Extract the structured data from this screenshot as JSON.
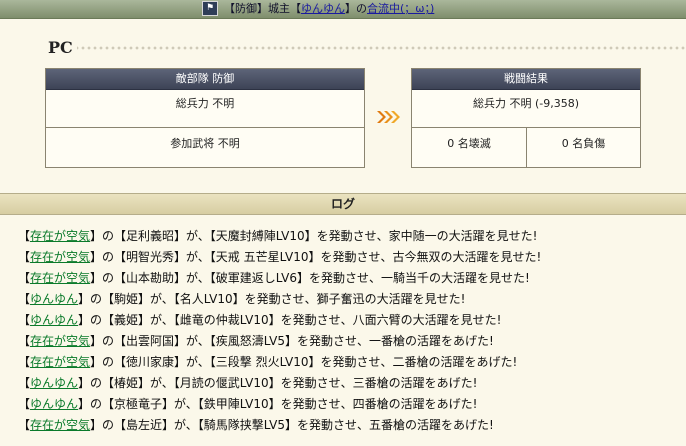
{
  "title_bar": {
    "prefix": "【防御】城主【",
    "lord_name": "ゆんゆん",
    "middle": "】の",
    "link": "合流中(；ω；)",
    "icon": "castle-flag-icon"
  },
  "section": {
    "label": "PC"
  },
  "left_panel": {
    "header": "敵部隊 防御",
    "total_strength": "総兵力 不明",
    "participants": "参加武将 不明"
  },
  "right_panel": {
    "header": "戦闘結果",
    "total_strength": "総兵力 不明 (-9,358)",
    "destroyed": "0 名壊滅",
    "wounded": "0 名負傷"
  },
  "arrow_icon": "triple-chevron-right-icon",
  "log": {
    "header": "ログ",
    "entries": [
      {
        "actor": "存在が空気",
        "text": "の【足利義昭】が、【天魔封縛陣LV10】を発動させ、家中随一の大活躍を見せた!"
      },
      {
        "actor": "存在が空気",
        "text": "の【明智光秀】が、【天戒 五芒星LV10】を発動させ、古今無双の大活躍を見せた!"
      },
      {
        "actor": "存在が空気",
        "text": "の【山本勘助】が、【破軍建返しLV6】を発動させ、一騎当千の大活躍を見せた!"
      },
      {
        "actor": "ゆんゆん",
        "text": "の【駒姫】が、【名人LV10】を発動させ、獅子奮迅の大活躍を見せた!"
      },
      {
        "actor": "ゆんゆん",
        "text": "の【義姫】が、【雌竜の仲裁LV10】を発動させ、八面六臂の大活躍を見せた!"
      },
      {
        "actor": "存在が空気",
        "text": "の【出雲阿国】が、【疾風怒濤LV5】を発動させ、一番槍の活躍をあげた!"
      },
      {
        "actor": "存在が空気",
        "text": "の【徳川家康】が、【三段撃 烈火LV10】を発動させ、二番槍の活躍をあげた!"
      },
      {
        "actor": "ゆんゆん",
        "text": "の【椿姫】が、【月読の偃武LV10】を発動させ、三番槍の活躍をあげた!"
      },
      {
        "actor": "ゆんゆん",
        "text": "の【京極竜子】が、【鉄甲陣LV10】を発動させ、四番槍の活躍をあげた!"
      },
      {
        "actor": "存在が空気",
        "text": "の【島左近】が、【騎馬隊挟撃LV5】を発動させ、五番槍の活躍をあげた!"
      }
    ]
  }
}
